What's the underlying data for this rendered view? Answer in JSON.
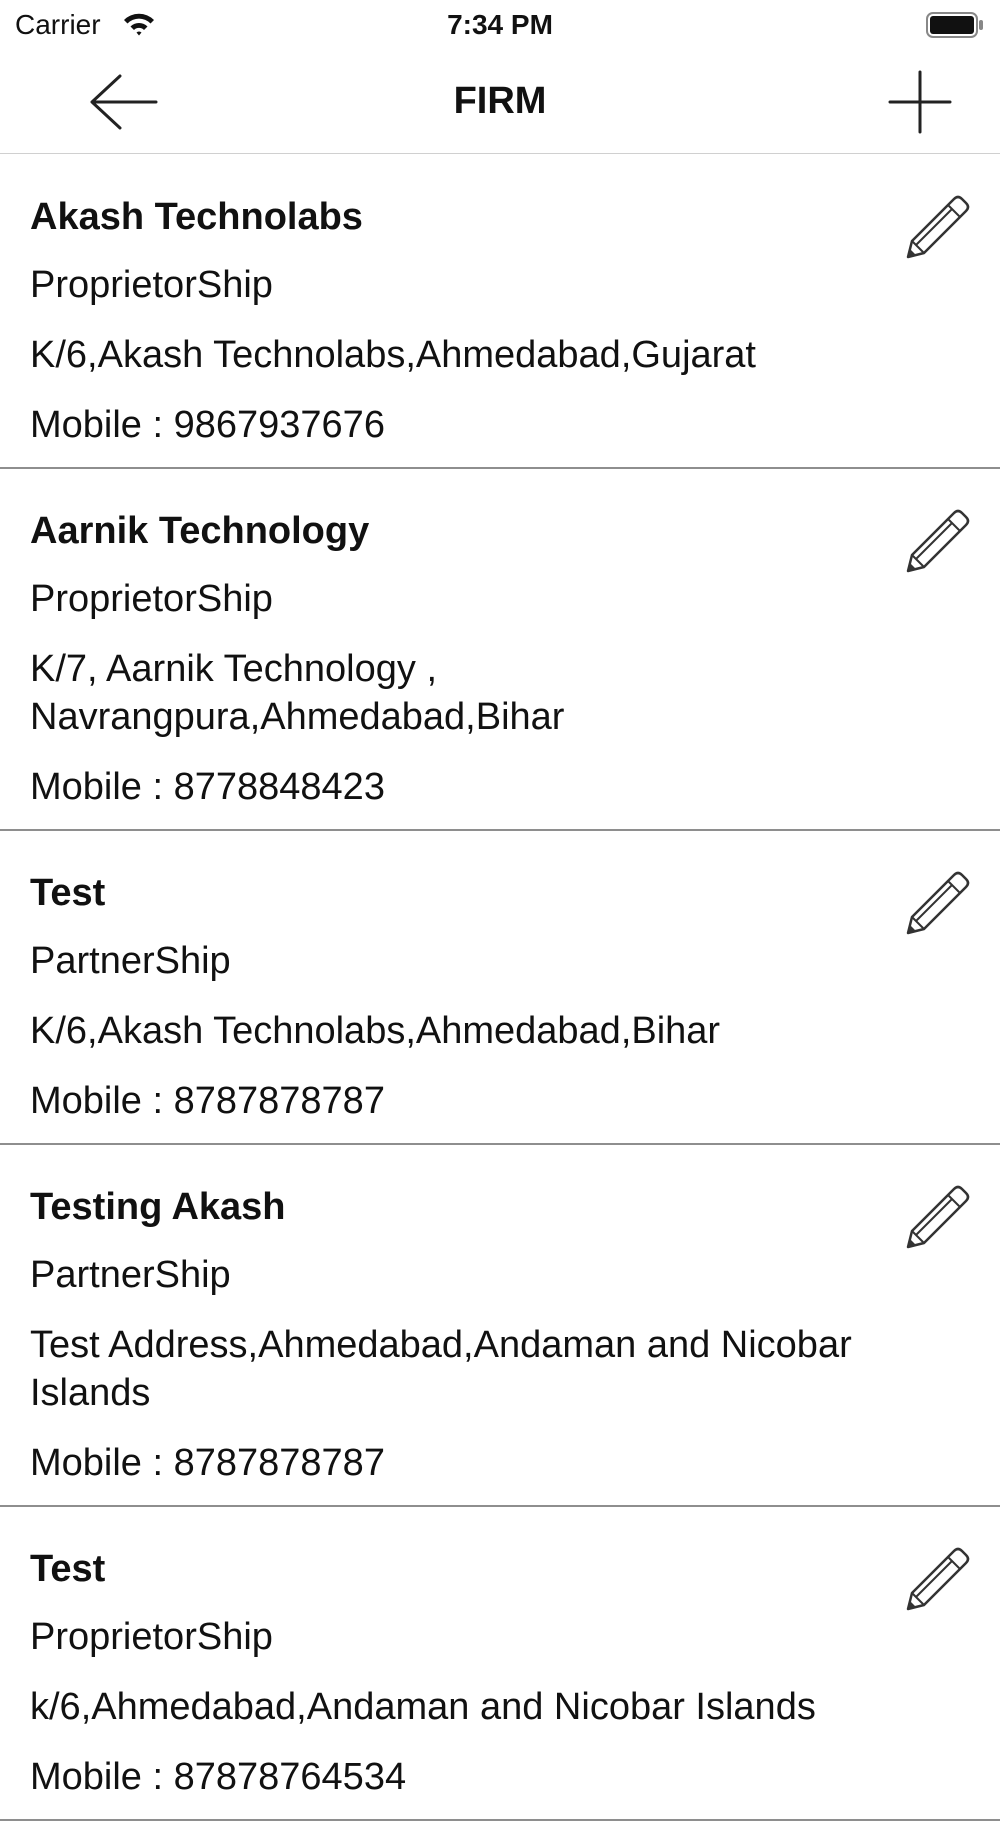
{
  "status_bar": {
    "carrier": "Carrier",
    "time": "7:34 PM",
    "wifi_icon": "wifi-icon",
    "battery_icon": "battery-icon"
  },
  "nav": {
    "title": "FIRM",
    "back_icon": "arrow-left-icon",
    "add_icon": "plus-icon"
  },
  "firms": [
    {
      "name": "Akash Technolabs",
      "type": "ProprietorShip",
      "address": "K/6,Akash Technolabs,Ahmedabad,Gujarat",
      "mobile": "Mobile : 9867937676"
    },
    {
      "name": "Aarnik Technology",
      "type": "ProprietorShip",
      "address": "K/7, Aarnik Technology , Navrangpura,Ahmedabad,Bihar",
      "mobile": "Mobile : 8778848423"
    },
    {
      "name": "Test",
      "type": "PartnerShip",
      "address": "K/6,Akash Technolabs,Ahmedabad,Bihar",
      "mobile": "Mobile : 8787878787"
    },
    {
      "name": "Testing Akash",
      "type": "PartnerShip",
      "address": "Test Address,Ahmedabad,Andaman and Nicobar Islands",
      "mobile": "Mobile : 8787878787"
    },
    {
      "name": "Test",
      "type": "ProprietorShip",
      "address": "k/6,Ahmedabad,Andaman and Nicobar Islands",
      "mobile": "Mobile : 87878764534"
    }
  ],
  "edit_icon": "pencil-icon"
}
